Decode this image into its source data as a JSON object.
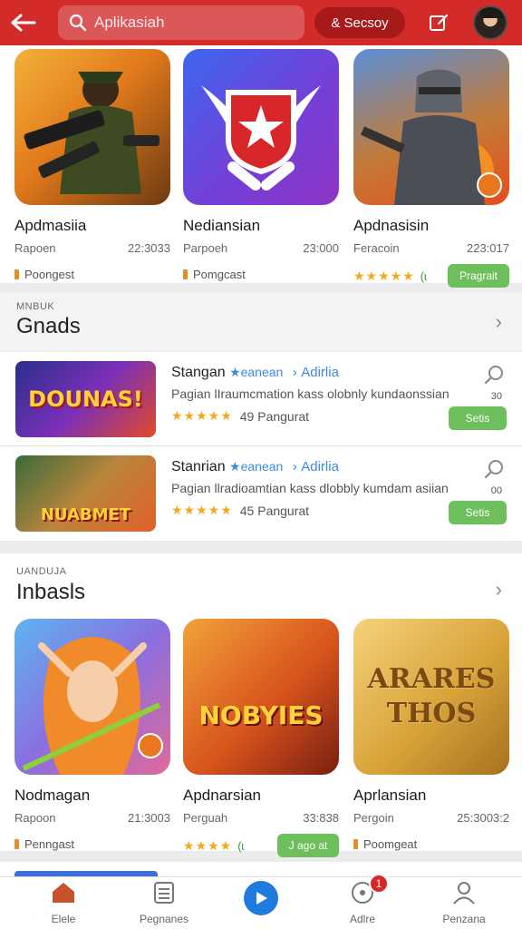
{
  "topbar": {
    "search_placeholder": "Aplikasiah",
    "account_label": "& Secsoy",
    "accent": "#d32a2a"
  },
  "featured": [
    {
      "name": "Apdmasiia",
      "dev": "Rapoen",
      "size": "22:3033",
      "badge": "Poongest",
      "icon": "soldier-artwork"
    },
    {
      "name": "Nediansian",
      "dev": "Parpoeh",
      "size": "23:000",
      "badge": "Pomgcast",
      "icon": "shield-star-logo"
    },
    {
      "name": "Apdnasisin",
      "dev": "Feracoin",
      "size": "223:017",
      "stars": "★★★★★",
      "rating_extra": "(ɩ",
      "button": "Pragrait",
      "icon": "knight-artwork"
    }
  ],
  "section1": {
    "kicker": "MNBUK",
    "title": "Gnads",
    "chevron": "›"
  },
  "list": [
    {
      "title": "Stangan",
      "verified": "★eanean",
      "sep": "›",
      "cat": "Adirlia",
      "desc": "Pagian lIraumcmation kass olobnly kundaonssian",
      "stars": "★★★★★",
      "rating_text": "49 Pangurat",
      "count": "30",
      "button": "Setis",
      "thumb_text": "DOUNAS!"
    },
    {
      "title": "Stanrian",
      "verified": "★eanean",
      "sep": "›",
      "cat": "Adirlia",
      "desc": "Pagian llradioamtian kass dlobbly kumdam asiian",
      "stars": "★★★★★",
      "rating_text": "45 Pangurat",
      "count": "00",
      "button": "Setis",
      "thumb_text": "NUABMET"
    }
  ],
  "section2": {
    "kicker": "UANDUJA",
    "title": "Inbasls",
    "chevron": "›"
  },
  "grid2": [
    {
      "name": "Nodmagan",
      "dev": "Rapoon",
      "size": "21:3003",
      "badge": "Penngast",
      "icon": "elf-archer-artwork"
    },
    {
      "name": "Apdnarsian",
      "dev": "Perguah",
      "size": "33:838",
      "stars": "★★★★",
      "rating_extra": "(ɩ",
      "button": "J ago at",
      "icon": "ninja-artwork",
      "thumb_text": "NOBYIES"
    },
    {
      "name": "Aprlansian",
      "dev": "Pergoin",
      "size": "25:3003:2",
      "badge": "Poomgeat",
      "icon": "text-logo",
      "thumb_text": "ARARES THOS"
    }
  ],
  "nav": [
    {
      "label": "Elele",
      "icon": "home-icon"
    },
    {
      "label": "Pegnanes",
      "icon": "library-icon"
    },
    {
      "label": "",
      "icon": "play-icon"
    },
    {
      "label": "Adlre",
      "icon": "notifications-icon",
      "badge": "1"
    },
    {
      "label": "Penzana",
      "icon": "profile-icon"
    }
  ]
}
